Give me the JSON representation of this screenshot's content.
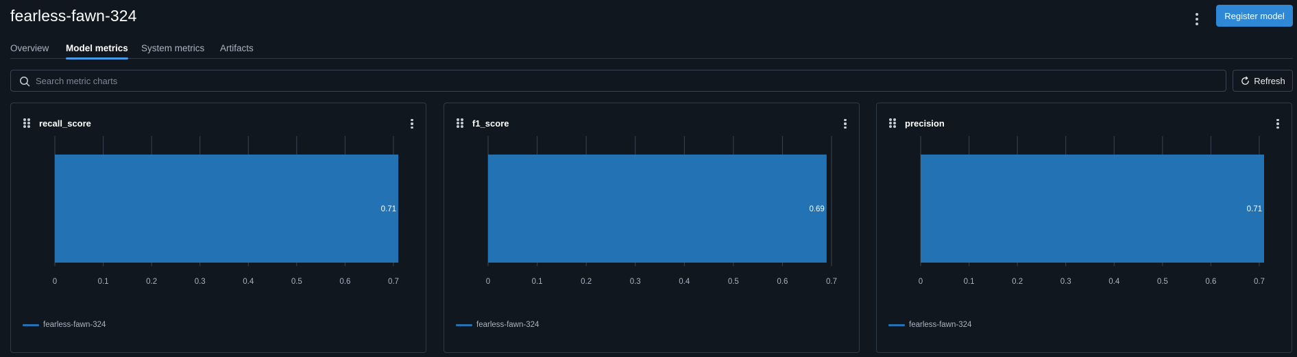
{
  "header": {
    "run_name": "fearless-fawn-324",
    "register_label": "Register model"
  },
  "tabs": [
    {
      "label": "Overview",
      "active": false
    },
    {
      "label": "Model metrics",
      "active": true
    },
    {
      "label": "System metrics",
      "active": false
    },
    {
      "label": "Artifacts",
      "active": false
    }
  ],
  "search": {
    "placeholder": "Search metric charts",
    "value": ""
  },
  "refresh_label": "Refresh",
  "colors": {
    "accent": "#2f88d6",
    "bar": "#2272b4",
    "background": "#11171f"
  },
  "chart_data": [
    {
      "type": "bar",
      "title": "recall_score",
      "orientation": "horizontal",
      "categories": [
        "fearless-fawn-324"
      ],
      "values": [
        0.71
      ],
      "data_labels": [
        "0.71"
      ],
      "xlim": [
        0,
        0.71
      ],
      "xticks": [
        "0",
        "0.1",
        "0.2",
        "0.3",
        "0.4",
        "0.5",
        "0.6",
        "0.7"
      ],
      "grid": true,
      "legend": {
        "position": "bottom-left",
        "entries": [
          "fearless-fawn-324"
        ]
      }
    },
    {
      "type": "bar",
      "title": "f1_score",
      "orientation": "horizontal",
      "categories": [
        "fearless-fawn-324"
      ],
      "values": [
        0.69
      ],
      "data_labels": [
        "0.69"
      ],
      "xlim": [
        0,
        0.7
      ],
      "xticks": [
        "0",
        "0.1",
        "0.2",
        "0.3",
        "0.4",
        "0.5",
        "0.6",
        "0.7"
      ],
      "grid": true,
      "legend": {
        "position": "bottom-left",
        "entries": [
          "fearless-fawn-324"
        ]
      }
    },
    {
      "type": "bar",
      "title": "precision",
      "orientation": "horizontal",
      "categories": [
        "fearless-fawn-324"
      ],
      "values": [
        0.71
      ],
      "data_labels": [
        "0.71"
      ],
      "xlim": [
        0,
        0.71
      ],
      "xticks": [
        "0",
        "0.1",
        "0.2",
        "0.3",
        "0.4",
        "0.5",
        "0.6",
        "0.7"
      ],
      "grid": true,
      "legend": {
        "position": "bottom-left",
        "entries": [
          "fearless-fawn-324"
        ]
      }
    }
  ]
}
